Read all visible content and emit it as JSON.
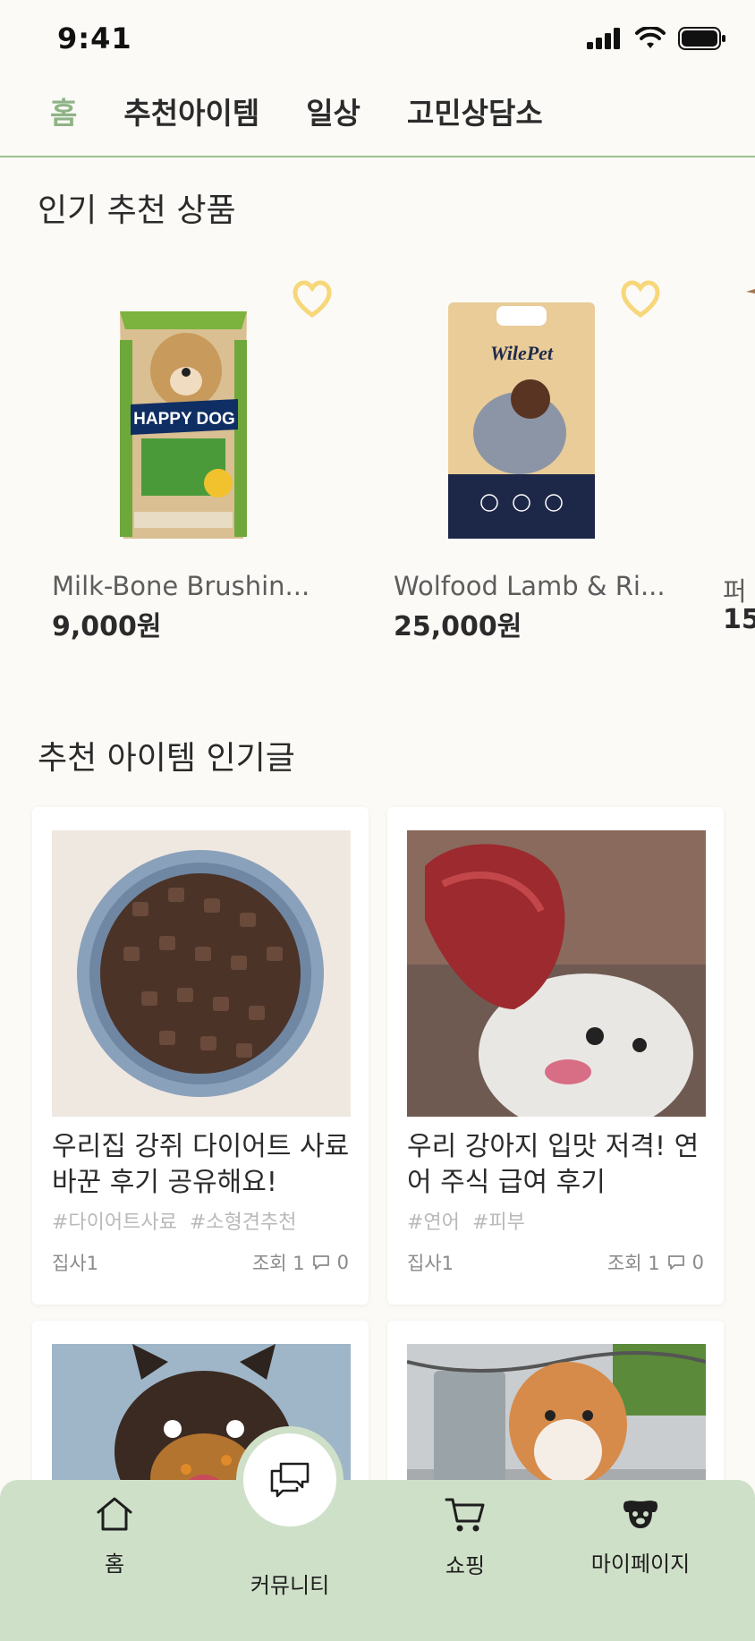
{
  "status_bar": {
    "time": "9:41"
  },
  "tabs": [
    {
      "label": "홈",
      "active": true
    },
    {
      "label": "추천아이템",
      "active": false
    },
    {
      "label": "일상",
      "active": false
    },
    {
      "label": "고민상담소",
      "active": false
    }
  ],
  "popular_products": {
    "title": "인기 추천 상품",
    "items": [
      {
        "name": "Milk-Bone Brushin...",
        "price": "9,000원",
        "brand_text": "HAPPY DOG",
        "liked": false
      },
      {
        "name": "Wolfood Lamb & Ri...",
        "price": "25,000원",
        "brand_text": "WilePet",
        "liked": false
      },
      {
        "name": "퍼",
        "price": "15,",
        "liked": false
      }
    ]
  },
  "popular_posts": {
    "title": "추천 아이템 인기글",
    "items": [
      {
        "title": "우리집 강쥐 다이어트 사료 바꾼 후기 공유해요!",
        "tags": [
          "#다이어트사료",
          "#소형견추천"
        ],
        "author": "집사1",
        "views": "조회 1",
        "comments": "0"
      },
      {
        "title": "우리 강아지 입맛 저격! 연어 주식 급여 후기",
        "tags": [
          "#연어",
          "#피부"
        ],
        "author": "집사1",
        "views": "조회 1",
        "comments": "0"
      }
    ]
  },
  "bottom_nav": [
    {
      "label": "홈",
      "icon": "home-icon"
    },
    {
      "label": "커뮤니티",
      "icon": "chat-icon"
    },
    {
      "label": "쇼핑",
      "icon": "cart-icon"
    },
    {
      "label": "마이페이지",
      "icon": "dog-face-icon"
    }
  ],
  "colors": {
    "accent": "#8fb386",
    "nav_bg": "#cfe0c8",
    "heart": "#f6d77a"
  }
}
